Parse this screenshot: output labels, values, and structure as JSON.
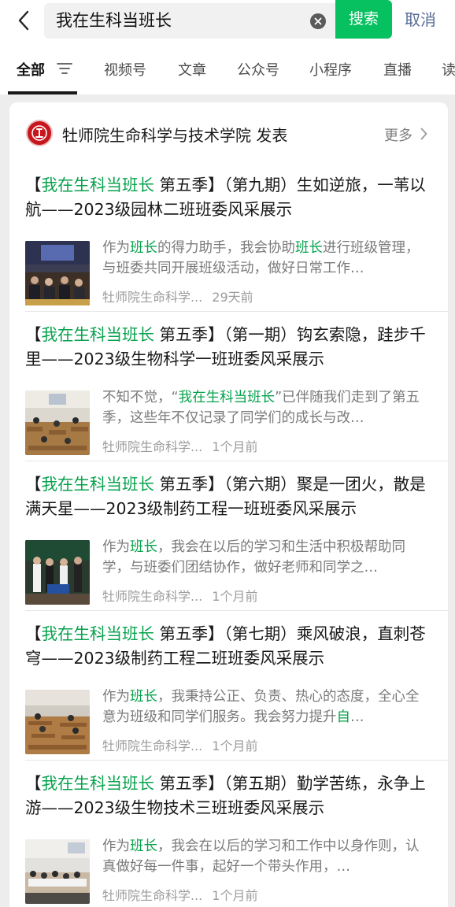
{
  "search": {
    "query": "我在生科当班长",
    "button_label": "搜索",
    "cancel_label": "取消"
  },
  "tabs": [
    {
      "label": "全部"
    },
    {
      "label": "视频号"
    },
    {
      "label": "文章"
    },
    {
      "label": "公众号"
    },
    {
      "label": "小程序"
    },
    {
      "label": "直播"
    },
    {
      "label": "读"
    }
  ],
  "source": {
    "name": "牡师院生命科学与技术学院 发表",
    "more_label": "更多"
  },
  "colors": {
    "accent": "#07c160",
    "highlight": "#07a24d",
    "link": "#576b95"
  },
  "results": [
    {
      "title_hl": "我在生科当班长",
      "title_rest": " 第五季】（第九期）生如逆旅，一苇以航——2023级园林二班班委风采展示",
      "title_prefix": "【",
      "snippet_parts": [
        "作为",
        "班长",
        "的得力助手，我会协助",
        "班长",
        "进行班级管理，与班委共同开展班级活动，做好日常工作…"
      ],
      "source": "牡师院生命科学...",
      "time": "29天前"
    },
    {
      "title_hl": "我在生科当班长",
      "title_rest": " 第五季】（第一期）钩玄索隐，跬步千里——2023级生物科学一班班委风采展示",
      "title_prefix": "【",
      "snippet_parts": [
        "不知不觉，“",
        "我在生科当班长",
        "”已伴随我们走到了第五季，这些年不仅记录了同学们的成长与改…",
        "",
        ""
      ],
      "source": "牡师院生命科学...",
      "time": "1个月前"
    },
    {
      "title_hl": "我在生科当班长",
      "title_rest": " 第五季】（第六期）聚是一团火，散是满天星——2023级制药工程一班班委风采展示",
      "title_prefix": "【",
      "snippet_parts": [
        "作为",
        "班长",
        "，我会在以后的学习和生活中积极帮助同学，与班委们团结协作，做好老师和同学之…",
        "",
        ""
      ],
      "source": "牡师院生命科学...",
      "time": "1个月前"
    },
    {
      "title_hl": "我在生科当班长",
      "title_rest": " 第五季】（第七期）乘风破浪，直刺苍穹——2023级制药工程二班班委风采展示",
      "title_prefix": "【",
      "snippet_parts": [
        "作为",
        "班长",
        "，我秉持公正、负责、热心的态度，全心全意为班级和同学们服务。我会努力提升",
        "自",
        "…"
      ],
      "source": "牡师院生命科学...",
      "time": "1个月前"
    },
    {
      "title_hl": "我在生科当班长",
      "title_rest": " 第五季】（第五期）勤学苦练，永争上游——2023级生物技术三班班委风采展示",
      "title_prefix": "【",
      "snippet_parts": [
        "作为",
        "班长",
        "，我会在以后的学习和工作中以身作则，认真做好每一件事，起好一个带头作用，…",
        "",
        ""
      ],
      "source": "牡师院生命科学...",
      "time": "1个月前"
    }
  ]
}
